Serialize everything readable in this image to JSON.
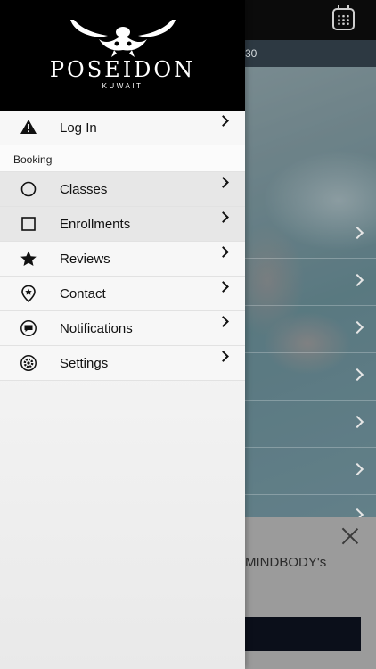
{
  "background": {
    "strip_text": "30",
    "banner_text": "MINDBODY's"
  },
  "drawer": {
    "brand": {
      "title": "POSEIDON",
      "subtitle": "KUWAIT"
    },
    "login": {
      "label": "Log In",
      "icon": "warning-icon"
    },
    "section_label": "Booking",
    "items": [
      {
        "label": "Classes",
        "icon": "circle-icon"
      },
      {
        "label": "Enrollments",
        "icon": "square-icon"
      },
      {
        "label": "Reviews",
        "icon": "star-icon"
      },
      {
        "label": "Contact",
        "icon": "location-pin-icon"
      },
      {
        "label": "Notifications",
        "icon": "chat-bubble-icon"
      },
      {
        "label": "Settings",
        "icon": "gear-icon"
      }
    ]
  }
}
